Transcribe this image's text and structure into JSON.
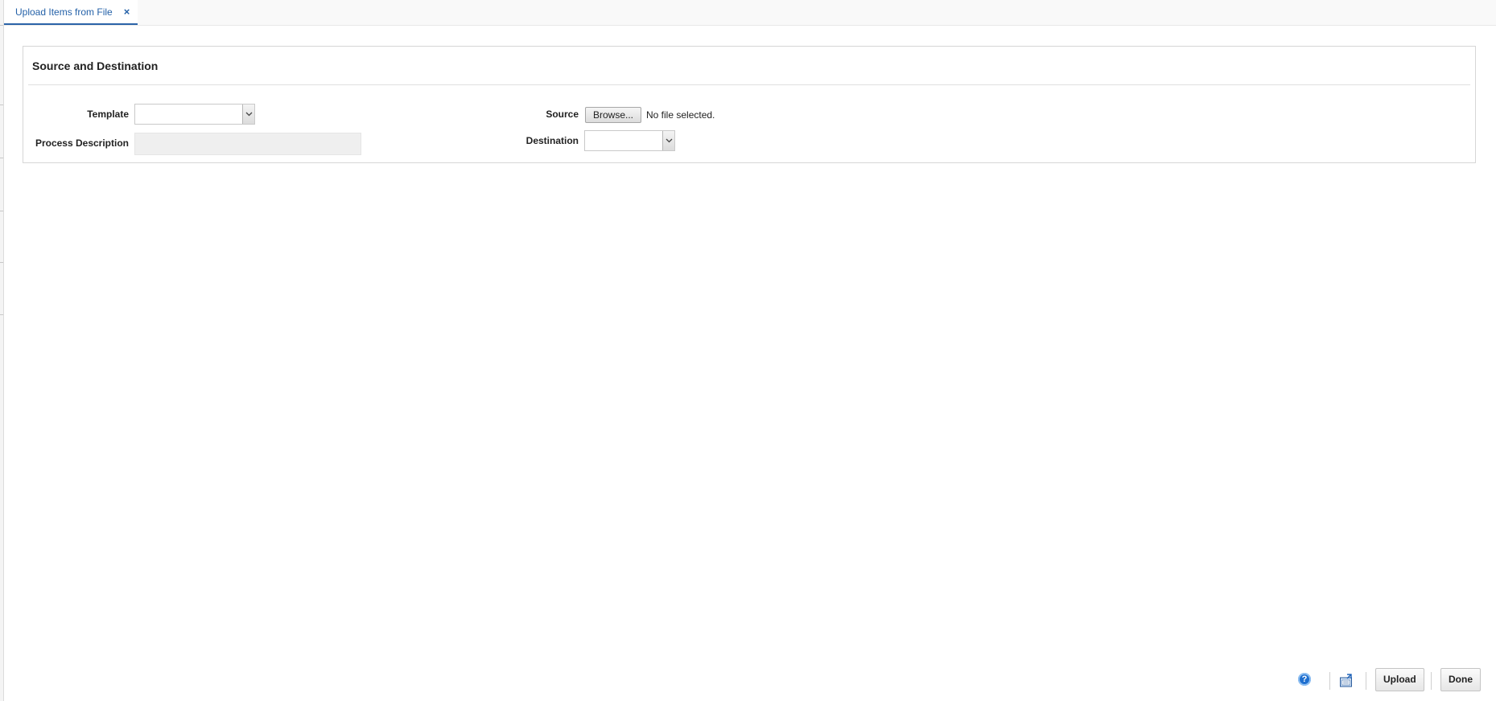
{
  "tab": {
    "title": "Upload Items from File",
    "close_glyph": "×"
  },
  "panel": {
    "title": "Source and Destination"
  },
  "form": {
    "template_label": "Template",
    "template_value": "",
    "process_description_label": "Process Description",
    "process_description_value": "",
    "source_label": "Source",
    "browse_label": "Browse...",
    "file_status": "No file selected.",
    "destination_label": "Destination",
    "destination_value": ""
  },
  "footer": {
    "help_glyph": "?",
    "upload_label": "Upload",
    "done_label": "Done"
  },
  "icons": {
    "help": "help-icon",
    "export": "export-icon",
    "dropdown": "chevron-down-icon",
    "close": "close-icon"
  },
  "colors": {
    "accent": "#2461a8",
    "help_blue": "#1f6fcf"
  }
}
